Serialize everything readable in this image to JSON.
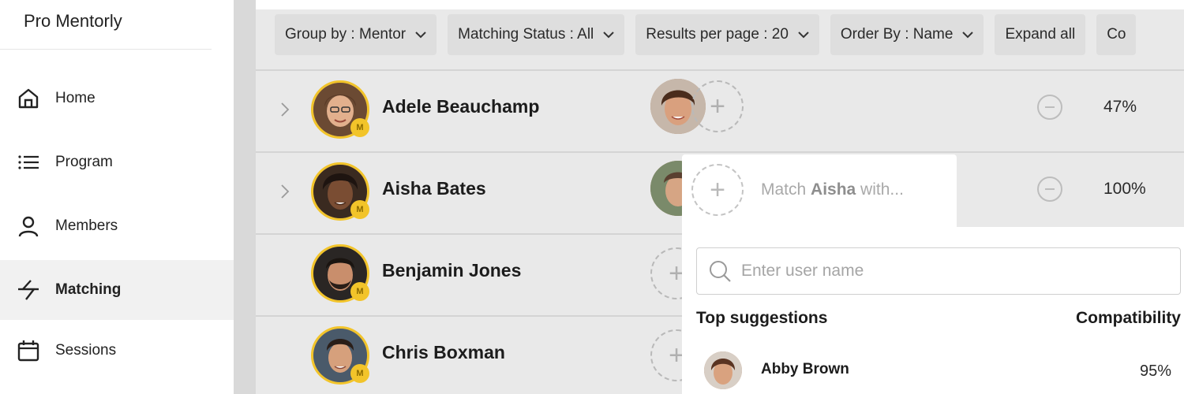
{
  "sidebar": {
    "brand": "Pro Mentorly",
    "items": [
      {
        "label": "Home",
        "icon": "home-icon"
      },
      {
        "label": "Program",
        "icon": "list-icon"
      },
      {
        "label": "Members",
        "icon": "user-icon"
      },
      {
        "label": "Matching",
        "icon": "matching-icon",
        "active": true
      },
      {
        "label": "Sessions",
        "icon": "calendar-icon"
      }
    ]
  },
  "toolbar": {
    "group_by": "Group by : Mentor",
    "matching_status": "Matching Status : All",
    "results_per_page": "Results per page : 20",
    "order_by": "Order By : Name",
    "expand_all": "Expand all",
    "collapse_partial": "Co"
  },
  "rows": [
    {
      "name": "Adele Beauchamp",
      "percent": "47%",
      "badge": "M"
    },
    {
      "name": "Aisha Bates",
      "percent": "100%",
      "badge": "M"
    },
    {
      "name": "Benjamin Jones",
      "badge": "M"
    },
    {
      "name": "Chris Boxman",
      "badge": "M"
    }
  ],
  "match_popup": {
    "prefix": "Match ",
    "name": "Aisha",
    "suffix": " with...",
    "search_placeholder": "Enter user name",
    "top_suggestions": "Top suggestions",
    "compatibility": "Compatibility",
    "suggestions": [
      {
        "name": "Abby Brown",
        "percent": "95%"
      }
    ]
  },
  "colors": {
    "accent_yellow": "#f2c42a",
    "main_background": "#e9e9e9",
    "active_nav": "#f1f1f1"
  }
}
